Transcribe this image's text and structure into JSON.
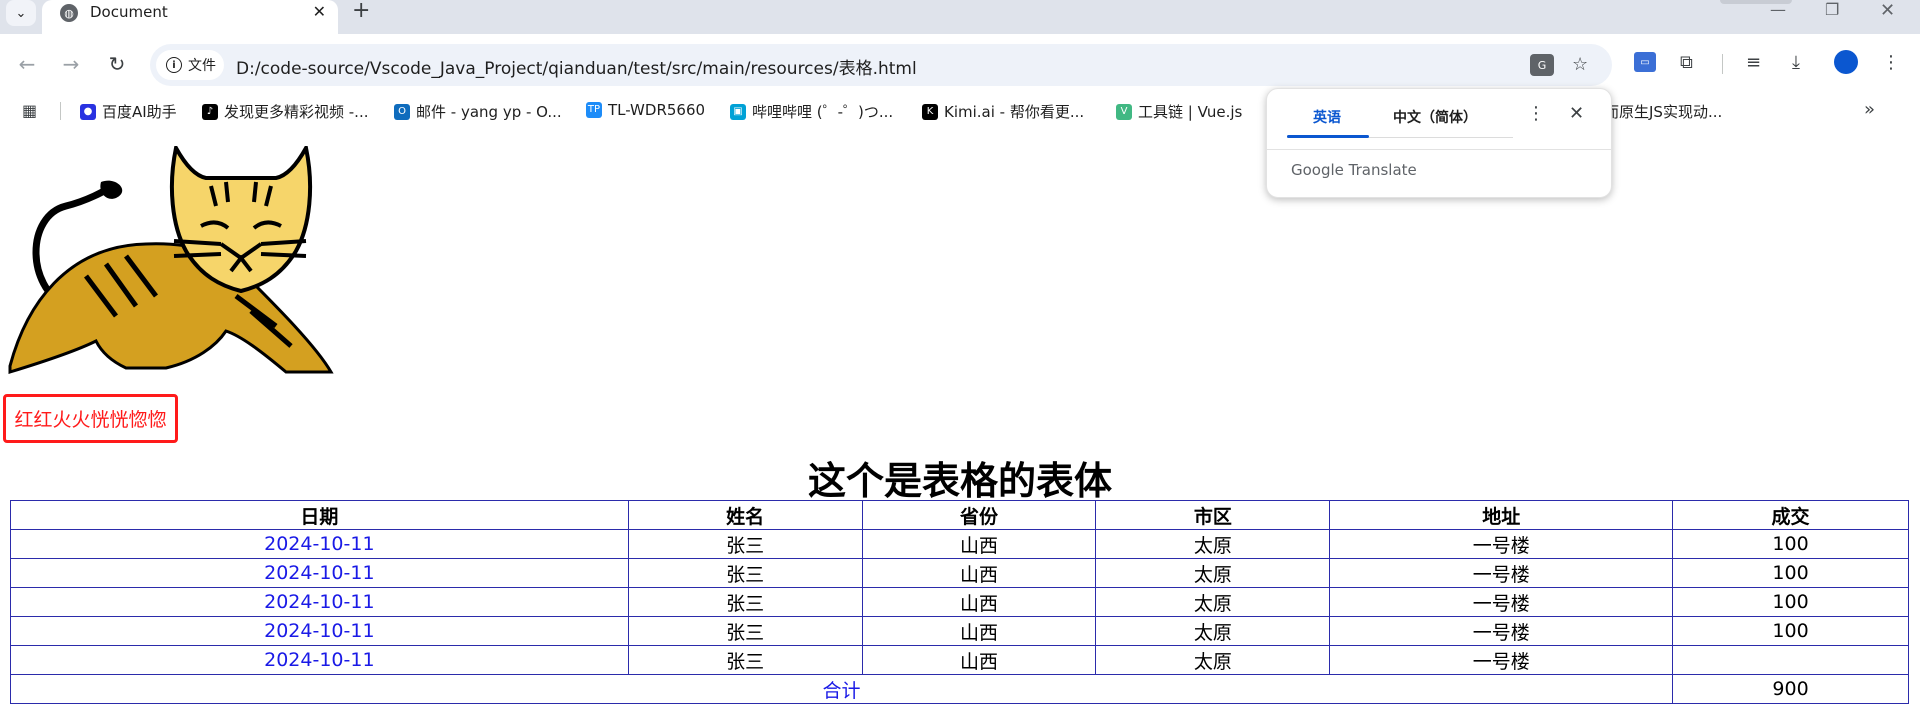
{
  "browser": {
    "tab_title": "Document",
    "tab_close": "✕",
    "new_tab": "+",
    "site_chip": "文件",
    "url": "D:/code-source/Vscode_Java_Project/qianduan/test/src/main/resources/表格.html"
  },
  "bookmarks": [
    {
      "label": "百度AI助手",
      "icon": "paw-icon",
      "color": "#2932e1"
    },
    {
      "label": "发现更多精彩视频 -...",
      "icon": "tiktok-icon",
      "color": "#000000"
    },
    {
      "label": "邮件 - yang yp - O...",
      "icon": "outlook-icon",
      "color": "#0f6cbd"
    },
    {
      "label": "TL-WDR5660",
      "icon": "tp-link-icon",
      "color": "#1d8cf8"
    },
    {
      "label": "哔哩哔哩 (゜-゜)つ...",
      "icon": "bilibili-icon",
      "color": "#00a1d6"
    },
    {
      "label": "Kimi.ai - 帮你看更...",
      "icon": "kimi-icon",
      "color": "#000000"
    },
    {
      "label": "工具链 | Vue.js",
      "icon": "vue-icon",
      "color": "#41b883"
    },
    {
      "label": "而原生JS实现动...",
      "icon": "",
      "color": ""
    }
  ],
  "translate_popup": {
    "tab_source": "英语",
    "tab_target": "中文（简体）",
    "brand": "Google Translate"
  },
  "page": {
    "logo": "tomcat-logo",
    "red_box_text": "红红火火恍恍惚惚",
    "heading": "这个是表格的表体",
    "table": {
      "headers": [
        "日期",
        "姓名",
        "省份",
        "市区",
        "地址",
        "成交"
      ],
      "rows": [
        [
          "2024-10-11",
          "张三",
          "山西",
          "太原",
          "一号楼",
          "100"
        ],
        [
          "2024-10-11",
          "张三",
          "山西",
          "太原",
          "一号楼",
          "100"
        ],
        [
          "2024-10-11",
          "张三",
          "山西",
          "太原",
          "一号楼",
          "100"
        ],
        [
          "2024-10-11",
          "张三",
          "山西",
          "太原",
          "一号楼",
          "100"
        ],
        [
          "2024-10-11",
          "张三",
          "山西",
          "太原",
          "一号楼",
          ""
        ]
      ],
      "total_label": "合计",
      "total_value": "900"
    }
  }
}
